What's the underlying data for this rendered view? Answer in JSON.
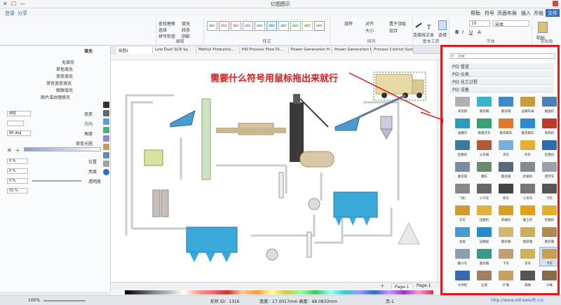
{
  "window": {
    "title": "亿图图示",
    "controls": [
      "—",
      "☐",
      "✕"
    ]
  },
  "menu_tabs": [
    "文件",
    "开始",
    "插入",
    "页面布局",
    "符号",
    "帮助"
  ],
  "ribbon": {
    "groups": [
      {
        "label": "文件",
        "items": []
      },
      {
        "label": "剪贴板",
        "items": [
          "粘贴"
        ]
      },
      {
        "label": "字体",
        "items": [
          "宋体",
          "10"
        ]
      },
      {
        "label": "基本工具",
        "items": [
          "选择",
          "文本",
          "连接线"
        ]
      },
      {
        "label": "排列",
        "items": [
          "置于顶层",
          "组合",
          "对齐",
          "大小",
          "旋转"
        ]
      },
      {
        "label": "样式",
        "items": [
          "abc",
          "abc",
          "abc",
          "abc",
          "abc",
          "abc",
          "abc",
          "abc",
          "abc",
          "abc"
        ]
      },
      {
        "label": "编辑",
        "items": [
          "查找替换",
          "选择",
          "拼写检查",
          "填充",
          "线条",
          "阴影"
        ]
      }
    ],
    "share_label": "分享",
    "login_label": "登录"
  },
  "doc_tabs": [
    "Process Control System",
    "Power Generation PID",
    "Power Generation H...",
    "PID Process Flow Di...",
    "Methyl Productio...",
    "Low Dust SCR Sy...",
    "绘图1"
  ],
  "annotation": "需要什么符号用鼠标拖出来就行",
  "left_panel": {
    "title": "填充",
    "options": [
      "无填充",
      "单色填充",
      "渐变填充",
      "单色渐变填充",
      "图案填充",
      "图片或纹理填充"
    ],
    "fields": [
      {
        "label": "渐变",
        "value": "线性"
      },
      {
        "label": "方向",
        "value": ""
      },
      {
        "label": "角度",
        "value": "90 deg"
      },
      {
        "label": "渐变光圈",
        "value": ""
      },
      {
        "label": "位置",
        "value": "0 %"
      },
      {
        "label": "亮度",
        "value": "0 %"
      },
      {
        "label": "透明度",
        "value": "0 %"
      },
      {
        "label": "",
        "value": "55 %"
      }
    ]
  },
  "page_bar": {
    "page_label": "Page-1",
    "add_label": "+",
    "current": "Page-1"
  },
  "status": {
    "url": "http://www.edrawsoft.cn/",
    "page": "页-1",
    "size": "宽度：17.0017mm  高度：48.0833mm",
    "shape_id": "形状 ID：1316",
    "zoom": "100%"
  },
  "library": {
    "search_placeholder": "搜索",
    "sections": [
      "PID 管道",
      "PID 仪表",
      "PID 化工过程",
      "PID 设备"
    ],
    "items": [
      {
        "label": "输送机",
        "color": "#4a7fb5"
      },
      {
        "label": "运输车辆",
        "color": "#c89b3c"
      },
      {
        "label": "集装箱",
        "color": "#3c8bc8"
      },
      {
        "label": "集装箱",
        "color": "#3cb3c8"
      },
      {
        "label": "高架桥",
        "color": "#b0b0b0"
      },
      {
        "label": "装卸机",
        "color": "#c0392b"
      },
      {
        "label": "集装箱车",
        "color": "#2f8bc8"
      },
      {
        "label": "集装箱车",
        "color": "#e07a2a"
      },
      {
        "label": "铁路货车",
        "color": "#3aa070"
      },
      {
        "label": "油罐车",
        "color": "#2a9dbb"
      },
      {
        "label": "起重机",
        "color": "#2b6cb0"
      },
      {
        "label": "吊车",
        "color": "#e0b03a"
      },
      {
        "label": "货车",
        "color": "#7ab0d8"
      },
      {
        "label": "火车厢",
        "color": "#b05a3a"
      },
      {
        "label": "起重机",
        "color": "#3a7aa0"
      },
      {
        "label": "搅拌车",
        "color": "#9aa0a8"
      },
      {
        "label": "挖掘机",
        "color": "#888"
      },
      {
        "label": "集装箱",
        "color": "#5a6a7a"
      },
      {
        "label": "罐车",
        "color": "#6a8a6a"
      },
      {
        "label": "散货船",
        "color": "#7a8aa0"
      },
      {
        "label": "卡车",
        "color": "#555"
      },
      {
        "label": "小货车",
        "color": "#777"
      },
      {
        "label": "轿车",
        "color": "#444"
      },
      {
        "label": "小汽车",
        "color": "#666"
      },
      {
        "label": "飞机",
        "color": "#888"
      },
      {
        "label": "挖掘机",
        "color": "#e0b030"
      },
      {
        "label": "推土机",
        "color": "#e0a020"
      },
      {
        "label": "装载机",
        "color": "#d8a028"
      },
      {
        "label": "压路机",
        "color": "#e0b040"
      },
      {
        "label": "叉车",
        "color": "#d09a30"
      },
      {
        "label": "集装箱",
        "color": "#b08a50"
      },
      {
        "label": "集装箱",
        "color": "#c8b060"
      },
      {
        "label": "集装箱",
        "color": "#d0b870"
      },
      {
        "label": "运输船",
        "color": "#2a8ac8"
      },
      {
        "label": "驳船",
        "color": "#4a9ad0"
      },
      {
        "label": "卡车",
        "color": "#c8a050"
      },
      {
        "label": "货车",
        "color": "#d0b060"
      },
      {
        "label": "卡车",
        "color": "#c0a070"
      },
      {
        "label": "集装箱",
        "color": "#3a9a8a"
      },
      {
        "label": "翻斗车",
        "color": "#8aa0b0"
      },
      {
        "label": "沙堆",
        "color": "#8a6a4a"
      },
      {
        "label": "煤堆",
        "color": "#555"
      },
      {
        "label": "矿堆",
        "color": "#c8a060"
      },
      {
        "label": "石堆",
        "color": "#a08060"
      },
      {
        "label": "文件柜",
        "color": "#3a6ab0"
      }
    ]
  }
}
